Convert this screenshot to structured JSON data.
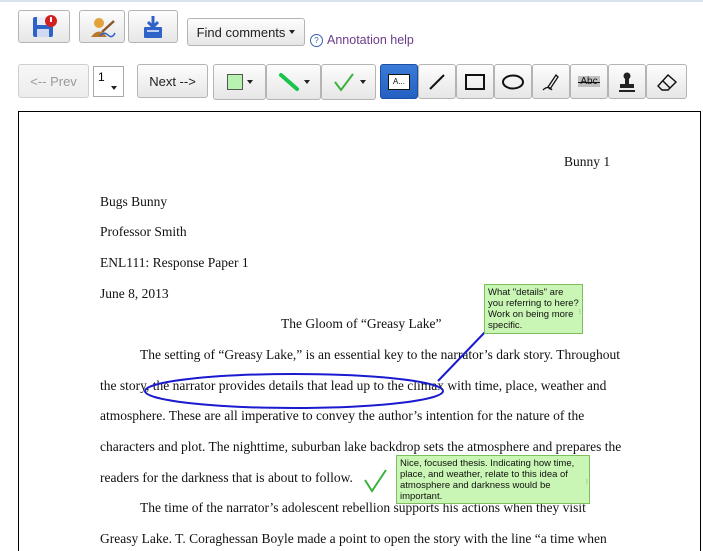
{
  "toolbar": {
    "find_comments_label": "Find comments",
    "annotation_help_label": "Annotation help",
    "help_icon_glyph": "?",
    "prev_label": "<-- Prev",
    "next_label": "Next -->",
    "page_value": "1",
    "text_tool_label": "A...",
    "strike_tool_label": "Abc"
  },
  "colors": {
    "highlight_fill": "#b7f2b0",
    "line_green": "#18c44a",
    "check_green": "#3bb33b",
    "ellipse_blue": "#1a1acf",
    "note_fill": "#c9f6b4",
    "active_tool": "#2563c6"
  },
  "document": {
    "header": "Bunny   1",
    "author": "Bugs Bunny",
    "professor": "Professor Smith",
    "course": "ENL111: Response Paper 1",
    "date": "June 8, 2013",
    "title": "The Gloom of “Greasy Lake”",
    "lines": [
      "The setting of “Greasy Lake,” is an essential key to the narrator’s dark story. Throughout",
      "the story, the narrator provides details that lead up to the climax with time, place, weather and",
      "atmosphere. These are all imperative to convey the author’s intention for the nature of the",
      "characters and plot. The nighttime, suburban lake backdrop sets the atmosphere and prepares the",
      "readers for the darkness that is about to follow.",
      "The time of the narrator’s adolescent rebellion supports his actions when they visit",
      "Greasy Lake. T. Coraghessan Boyle made a point to open the story with the line “a time when"
    ]
  },
  "annotations": {
    "note1": "What \"details\" are you referring to here? Work on being more specific.",
    "note2": "Nice, focused thesis. Indicating how time, place, and weather, relate to this idea of atmosphere and darkness would be important."
  }
}
